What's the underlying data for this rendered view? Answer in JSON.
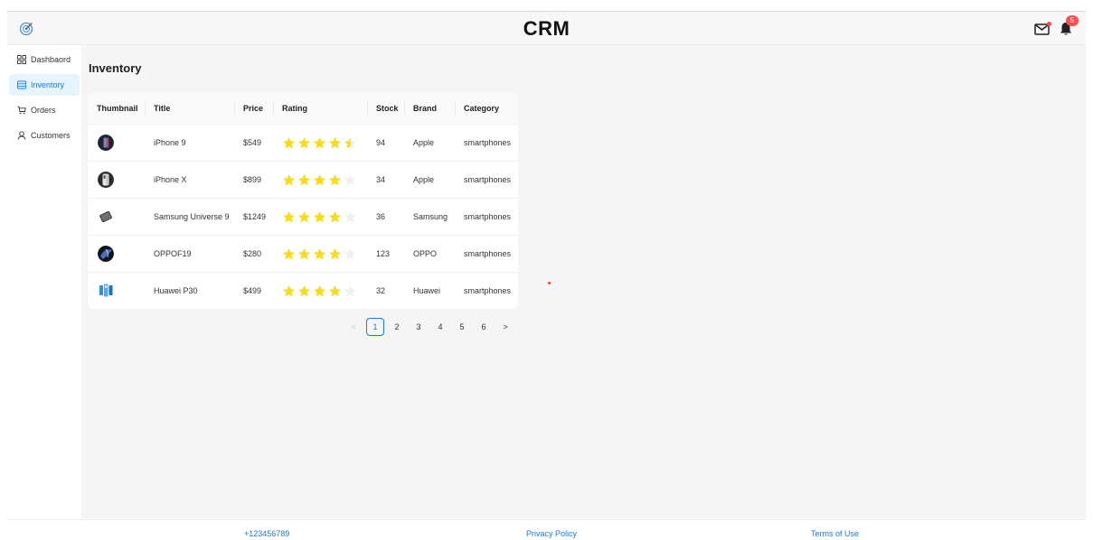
{
  "header": {
    "title": "CRM",
    "logo_icon": "target-logo-icon",
    "mail_icon": "mail-icon",
    "bell_icon": "bell-icon",
    "notification_count": "5"
  },
  "sidebar": {
    "items": [
      {
        "label": "Dashbaord",
        "icon": "grid-icon",
        "active": false
      },
      {
        "label": "Inventory",
        "icon": "table-icon",
        "active": true
      },
      {
        "label": "Orders",
        "icon": "cart-icon",
        "active": false
      },
      {
        "label": "Customers",
        "icon": "user-icon",
        "active": false
      }
    ]
  },
  "main": {
    "page_title": "Inventory",
    "table": {
      "columns": [
        "Thumbnail",
        "Title",
        "Price",
        "Rating",
        "Stock",
        "Brand",
        "Category"
      ],
      "rows": [
        {
          "title": "iPhone 9",
          "price": "$549",
          "rating": 4.5,
          "stock": "94",
          "brand": "Apple",
          "category": "smartphones"
        },
        {
          "title": "iPhone X",
          "price": "$899",
          "rating": 4,
          "stock": "34",
          "brand": "Apple",
          "category": "smartphones"
        },
        {
          "title": "Samsung Universe 9",
          "price": "$1249",
          "rating": 4,
          "stock": "36",
          "brand": "Samsung",
          "category": "smartphones"
        },
        {
          "title": "OPPOF19",
          "price": "$280",
          "rating": 4,
          "stock": "123",
          "brand": "OPPO",
          "category": "smartphones"
        },
        {
          "title": "Huawei P30",
          "price": "$499",
          "rating": 4,
          "stock": "32",
          "brand": "Huawei",
          "category": "smartphones"
        }
      ]
    },
    "pagination": {
      "prev": "<",
      "next": ">",
      "pages": [
        "1",
        "2",
        "3",
        "4",
        "5",
        "6"
      ],
      "current": "1"
    }
  },
  "footer": {
    "phone": "+123456789",
    "privacy": "Privacy Policy",
    "terms": "Terms of Use"
  },
  "colors": {
    "accent": "#1677ff",
    "star": "#fadb14",
    "star_empty": "#f0f0f0",
    "badge": "#ff4d4f"
  }
}
